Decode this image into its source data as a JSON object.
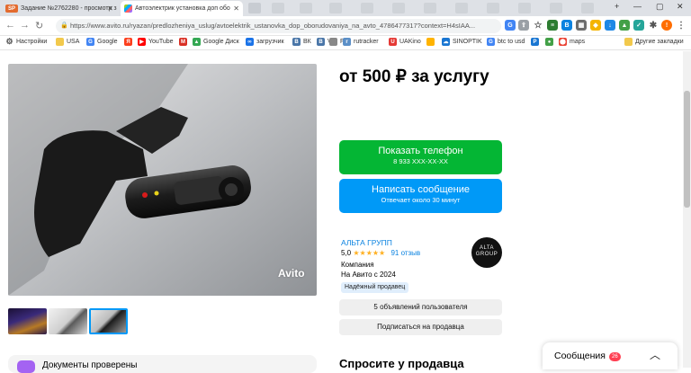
{
  "browser": {
    "tabs": [
      {
        "title": "Задание №2762280 - просмотр з",
        "favicon": "SP"
      },
      {
        "title": "Автоэлектрик установка доп обо",
        "favicon": ""
      }
    ],
    "url": "https://www.avito.ru/ryazan/predlozheniya_uslug/avtoelektrik_ustanovka_dop_oborudovaniya_na_avto_4786477317?context=H4sIAA...",
    "bookmarks": [
      "Настройки",
      "USA",
      "Google",
      "YouTube",
      "Google Диск",
      "загрузчик",
      "ВК",
      "rutracker",
      "UAKino",
      "SINOPTIK",
      "btc to usd",
      "maps",
      "Другие закладки"
    ],
    "bookmark_marks": [
      "VK",
      "F"
    ]
  },
  "listing": {
    "price": "от 500 ₽ за услугу",
    "watermark": "Avito",
    "call_button": {
      "label": "Показать телефон",
      "sub": "8 933 XXX-XX-XX"
    },
    "message_button": {
      "label": "Написать сообщение",
      "sub": "Отвечает около 30 минут"
    },
    "seller": {
      "name": "АЛЬТА ГРУПП",
      "rating": "5,0",
      "stars": "★★★★★",
      "reviews": "91 отзыв",
      "type": "Компания",
      "since": "На Авито с 2024",
      "badge": "Надёжный продавец",
      "logo_text": "ALTA GROUP"
    },
    "seller_listings_button": "5 объявлений пользователя",
    "subscribe_button": "Подписаться на продавца",
    "ask_heading": "Спросите у продавца",
    "docs_label": "Документы проверены"
  },
  "messenger": {
    "label": "Сообщения",
    "count": "26",
    "chevron": "chevron-up-icon"
  },
  "colors": {
    "green": "#04b634",
    "blue": "#0099f7",
    "link": "#0a82e0"
  }
}
